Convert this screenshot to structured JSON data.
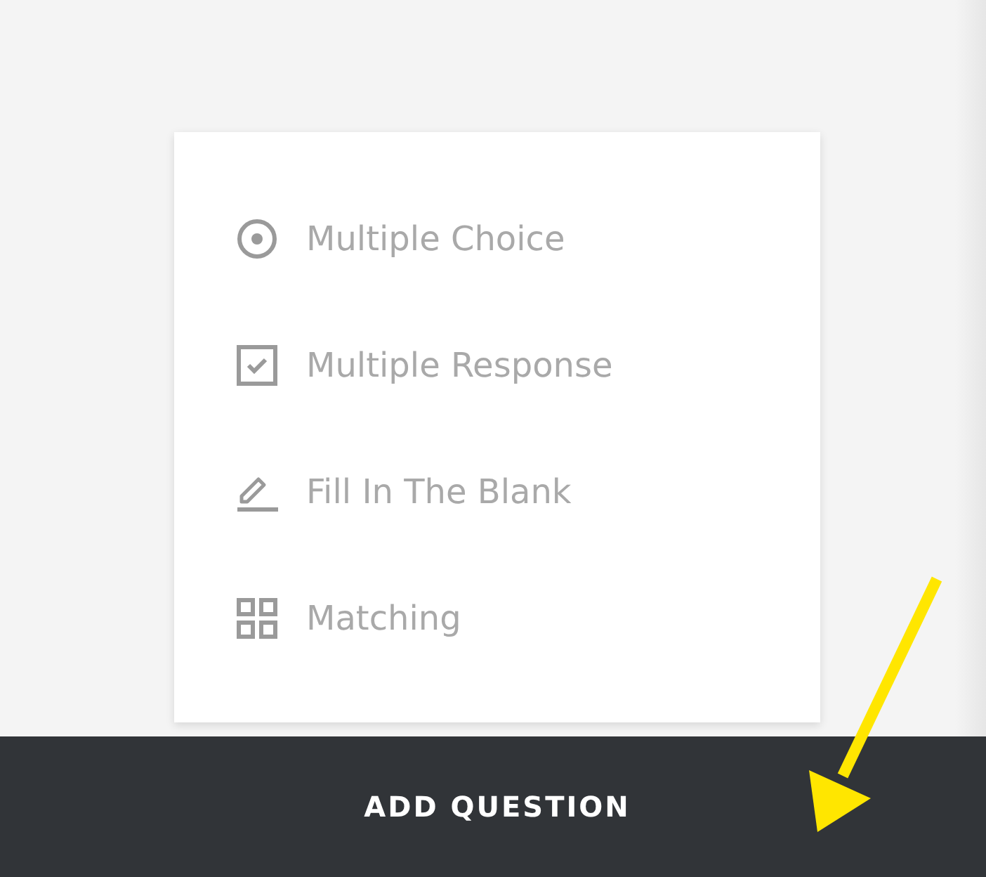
{
  "question_types": [
    {
      "kind": "radio",
      "label": "Multiple Choice"
    },
    {
      "kind": "checkbox",
      "label": "Multiple Response"
    },
    {
      "kind": "pencil",
      "label": "Fill In The Blank"
    },
    {
      "kind": "grid",
      "label": "Matching"
    }
  ],
  "footer": {
    "button": "ADD QUESTION"
  }
}
